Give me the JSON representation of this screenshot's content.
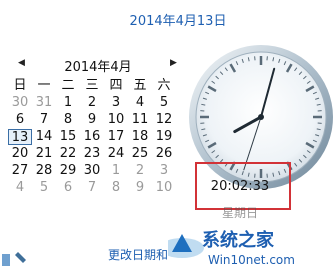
{
  "header": {
    "date": "2014年4月13日"
  },
  "calendar": {
    "prev_icon": "triangle-left-icon",
    "next_icon": "triangle-right-icon",
    "month_label": "2014年4月",
    "weekdays": [
      "日",
      "一",
      "二",
      "三",
      "四",
      "五",
      "六"
    ],
    "weeks": [
      [
        "30",
        "31",
        "1",
        "2",
        "3",
        "4",
        "5"
      ],
      [
        "6",
        "7",
        "8",
        "9",
        "10",
        "11",
        "12"
      ],
      [
        "13",
        "14",
        "15",
        "16",
        "17",
        "18",
        "19"
      ],
      [
        "20",
        "21",
        "22",
        "23",
        "24",
        "25",
        "26"
      ],
      [
        "27",
        "28",
        "29",
        "30",
        "1",
        "2",
        "3"
      ],
      [
        "4",
        "5",
        "6",
        "7",
        "8",
        "9",
        "10"
      ]
    ],
    "today": "13"
  },
  "clock": {
    "time": "20:02:33",
    "weekday": "星期日",
    "hour": 20,
    "minute": 2,
    "second": 33
  },
  "footer": {
    "link": "更改日期和"
  },
  "watermark": {
    "brand": "系统之家",
    "site": "Win10net.com"
  },
  "colors": {
    "accent": "#1e5fb1",
    "highlight_box": "#d23237"
  }
}
